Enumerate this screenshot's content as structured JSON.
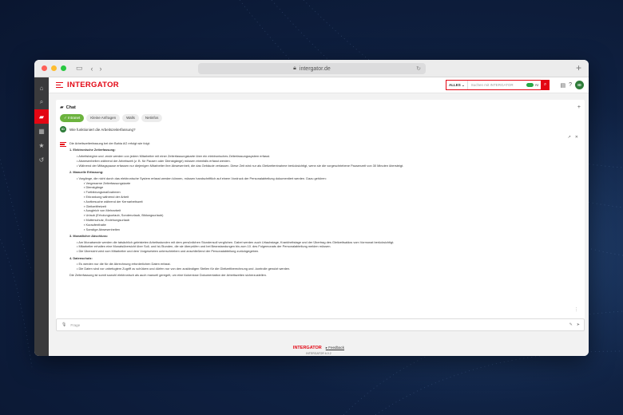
{
  "browser": {
    "url": "intergator.de"
  },
  "app": {
    "logo_text": "INTERGATOR",
    "search": {
      "scope": "ALLES",
      "placeholder": "Suchen mit INTERGATOR",
      "ai_label": "AI"
    },
    "avatar_initials": "ID"
  },
  "sidebar": {
    "items": [
      {
        "icon": "home-icon",
        "glyph": "⌂"
      },
      {
        "icon": "search-icon",
        "glyph": "⌕"
      },
      {
        "icon": "chat-icon",
        "glyph": "▰"
      },
      {
        "icon": "grid-icon",
        "glyph": "▦"
      },
      {
        "icon": "star-icon",
        "glyph": "★"
      },
      {
        "icon": "history-icon",
        "glyph": "↺"
      }
    ],
    "active_index": 2
  },
  "chat": {
    "title": "Chat",
    "tabs": [
      "Intranet",
      "Kleine Anfragen",
      "Walls",
      "Netinfos"
    ],
    "question": "Wie funktioniert die Arbeitszeiterfassung?",
    "answer": {
      "intro": "Die Arbeitszeiterfassung bei der Bahia AG erfolgt wie folgt:",
      "s1_title": "1. Elektronische Zeiterfassung:",
      "s1_items": [
        "Arbeitsbeginn und -ende werden von jedem Mitarbeiter mit einer Zeiterfassungskarte über ein elektronisches Zeiterfassungssystem erfasst.",
        "Abwesenheiten während der Arbeitszeit (z. B. für Pausen oder Dienstgänge) müssen ebenfalls erfasst werden.",
        "Während der Mittagspause erfassen nur diejenigen Mitarbeiter ihre Abwesenheit, die das Gebäude verlassen. Diese Zeit wird nur als Gleitzeitentnahme berücksichtigt, wenn sie die vorgeschriebene Pausenzeit von 30 Minuten übersteigt."
      ],
      "s2_title": "2. Manuelle Erfassung:",
      "s2_item": "Vorgänge, die nicht durch das elektronische System erfasst werden können, müssen handschriftlich auf einem Vordruck der Personalabteilung dokumentiert werden. Dazu gehören:",
      "s2_sub": [
        "Vergessene Zeiterfassungskarte",
        "Dienstgänge",
        "Fortbildungsmaßnahmen",
        "Erkrankung während der Arbeit",
        "Arztbesuche während der Kernarbeitszeit",
        "Gleitzeitfreizeit",
        "Ausgleich von Mehrarbeit",
        "Urlaub (Erholungsurlaub, Sonderurlaub, Bildungsurlaub)",
        "Mutterschutz, Erziehungsurlaub",
        "Kuraufenthalte",
        "Sonstige Abwesenheiten"
      ],
      "s3_title": "3. Monatlicher Abschluss:",
      "s3_items": [
        "Am Monatsende werden die tatsächlich geleisteten Arbeitsstunden mit dem persönlichen Stundensoll verglichen. Dabei werden auch Urlaubstage, Krankheitstage und der Übertrag des Gleitzeitsaldos vom Vormonat berücksichtigt.",
        "Mitarbeiter erhalten eine Monatsübersicht über Soll- und Ist-Stunden, die sie überprüfen und bei Beanstandungen bis zum 10. des Folgemonats der Personalabteilung melden müssen.",
        "Die Übersicht wird vom Mitarbeiter und dem Vorgesetzten unterschrieben und anschließend der Personalabteilung zurückgegeben."
      ],
      "s4_title": "4. Datenschutz:",
      "s4_items": [
        "Es werden nur die für die Abrechnung erforderlichen Daten erfasst.",
        "Die Daten sind vor unbefugtem Zugriff zu schützen und dürfen nur von den zuständigen Stellen für die Gleitzeitberechnung und -kontrolle genutzt werden."
      ],
      "outro": "Die Zeiterfassung ist somit sowohl elektronisch als auch manuell geregelt, um eine lückenlose Dokumentation der Arbeitszeiten sicherzustellen."
    },
    "input_placeholder": "Frage"
  },
  "footer": {
    "logo_text": "INTERGATOR",
    "feedback": "Feedback",
    "version": "INTERGATOR 6.0.2"
  },
  "colors": {
    "brand": "#e30613",
    "active_chip": "#6cb33e"
  }
}
